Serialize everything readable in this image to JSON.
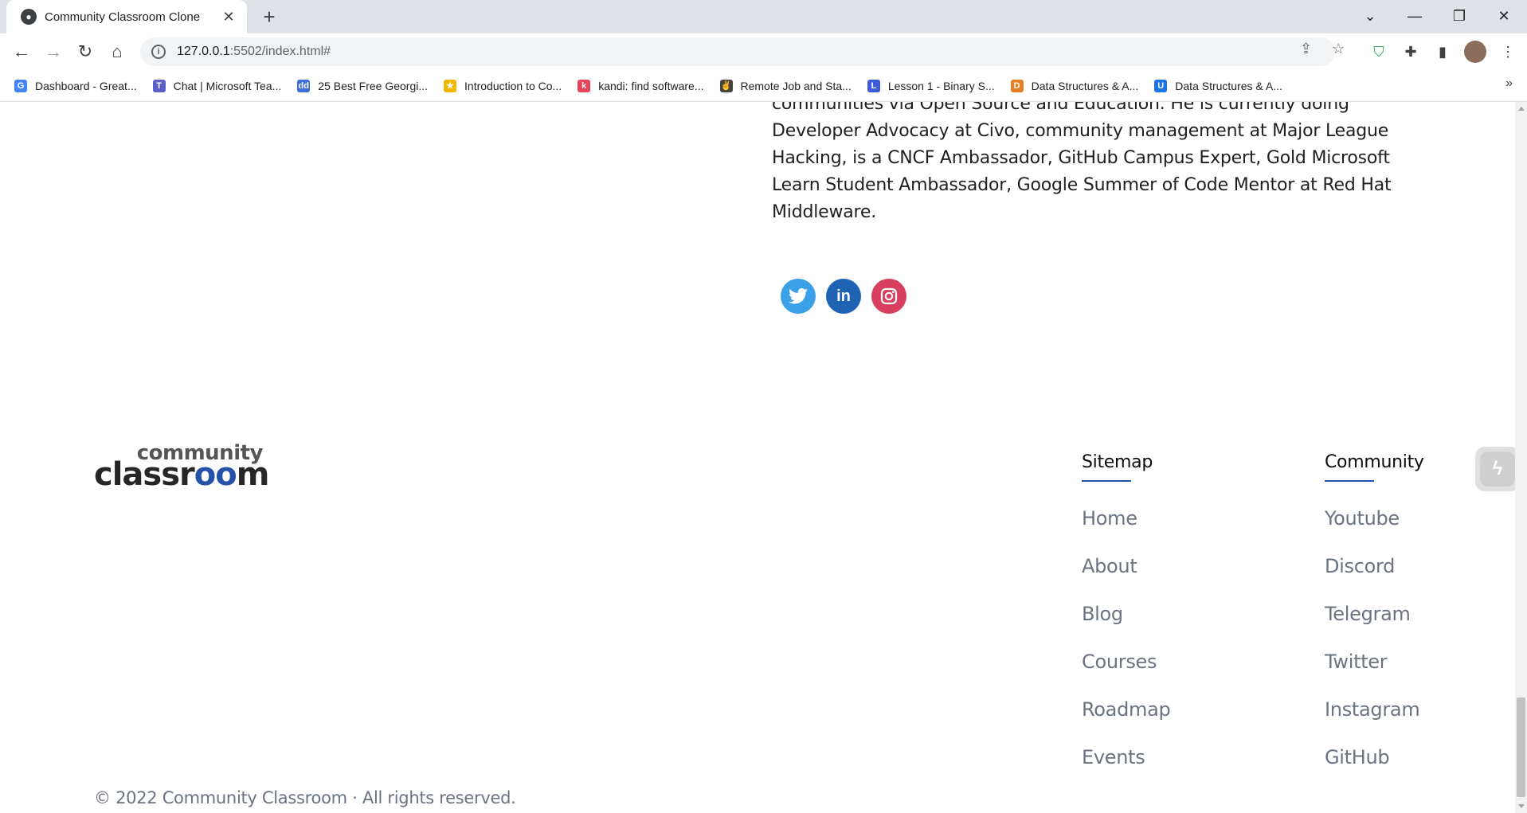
{
  "browser": {
    "tab_title": "Community Classroom Clone",
    "url_host": "127.0.0.1",
    "url_rest": ":5502/index.html#",
    "bookmarks": [
      {
        "label": "Dashboard - Great...",
        "color": "#4285f4",
        "glyph": "G"
      },
      {
        "label": "Chat | Microsoft Tea...",
        "color": "#5b5fc7",
        "glyph": "T"
      },
      {
        "label": "25 Best Free Georgi...",
        "color": "#3b6fe0",
        "glyph": "dd"
      },
      {
        "label": "Introduction to Co...",
        "color": "#f2b705",
        "glyph": "★"
      },
      {
        "label": "kandi: find software...",
        "color": "#e8435a",
        "glyph": "k"
      },
      {
        "label": "Remote Job and Sta...",
        "color": "#444444",
        "glyph": "✌"
      },
      {
        "label": "Lesson 1 - Binary S...",
        "color": "#3b5bdb",
        "glyph": "L"
      },
      {
        "label": "Data Structures & A...",
        "color": "#e67e22",
        "glyph": "D"
      },
      {
        "label": "Data Structures & A...",
        "color": "#1a73e8",
        "glyph": "U"
      }
    ]
  },
  "page": {
    "bio_text": "communities via Open Source and Education. He is currently doing Developer Advocacy at Civo, community management at Major League Hacking, is a CNCF Ambassador, GitHub Campus Expert, Gold Microsoft Learn Student Ambassador, Google Summer of Code Mentor at Red Hat Middleware.",
    "logo": {
      "line1": "community",
      "line2_a": "classr",
      "line2_b": "oo",
      "line2_c": "m"
    },
    "sitemap": {
      "heading": "Sitemap",
      "links": [
        "Home",
        "About",
        "Blog",
        "Courses",
        "Roadmap",
        "Events"
      ]
    },
    "community": {
      "heading": "Community",
      "links": [
        "Youtube",
        "Discord",
        "Telegram",
        "Twitter",
        "Instagram",
        "GitHub"
      ]
    },
    "copyright": "© 2022 Community Classroom · All rights reserved.",
    "accent_color": "#2452a8"
  }
}
